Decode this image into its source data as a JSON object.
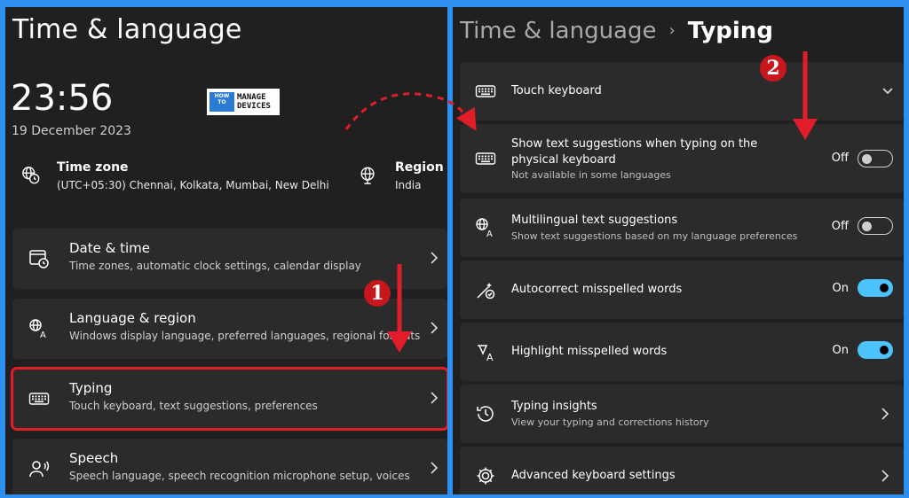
{
  "left": {
    "title": "Time & language",
    "clock": "23:56",
    "date": "19 December 2023",
    "logo": {
      "line1": "HOW",
      "line2": "TO",
      "word1": "MANAGE",
      "word2": "DEVICES"
    },
    "timezone": {
      "label": "Time zone",
      "value": "(UTC+05:30) Chennai, Kolkata, Mumbai, New Delhi"
    },
    "region": {
      "label": "Region",
      "value": "India"
    },
    "items": [
      {
        "title": "Date & time",
        "subtitle": "Time zones, automatic clock settings, calendar display",
        "icon": "clock-calendar-icon"
      },
      {
        "title": "Language & region",
        "subtitle": "Windows display language, preferred languages, regional formats",
        "icon": "language-icon"
      },
      {
        "title": "Typing",
        "subtitle": "Touch keyboard, text suggestions, preferences",
        "icon": "keyboard-icon",
        "selected": true
      },
      {
        "title": "Speech",
        "subtitle": "Speech language, speech recognition microphone setup, voices",
        "icon": "speech-icon"
      }
    ]
  },
  "right": {
    "breadcrumb_parent": "Time & language",
    "breadcrumb_sep": "›",
    "breadcrumb_current": "Typing",
    "items": [
      {
        "title": "Touch keyboard",
        "subtitle": "",
        "control": "expand",
        "icon": "keyboard-icon"
      },
      {
        "title": "Show text suggestions when typing on the physical keyboard",
        "subtitle": "Not available in some languages",
        "state": "Off",
        "control": "toggle",
        "icon": "keyboard-icon"
      },
      {
        "title": "Multilingual text suggestions",
        "subtitle": "Show text suggestions based on my language preferences",
        "state": "Off",
        "control": "toggle",
        "icon": "language-icon"
      },
      {
        "title": "Autocorrect misspelled words",
        "subtitle": "",
        "state": "On",
        "control": "toggle",
        "icon": "autocorrect-icon"
      },
      {
        "title": "Highlight misspelled words",
        "subtitle": "",
        "state": "On",
        "control": "toggle",
        "icon": "highlight-spelling-icon"
      },
      {
        "title": "Typing insights",
        "subtitle": "View your typing and corrections history",
        "control": "chevron",
        "icon": "history-icon"
      },
      {
        "title": "Advanced keyboard settings",
        "subtitle": "",
        "control": "chevron",
        "icon": "gear-icon"
      }
    ]
  },
  "annotations": {
    "badge1": "1",
    "badge2": "2"
  },
  "colors": {
    "accent": "#4cc2ff",
    "highlight": "#e21d2a",
    "badge": "#c8161d",
    "frame": "#2d8ff0"
  }
}
